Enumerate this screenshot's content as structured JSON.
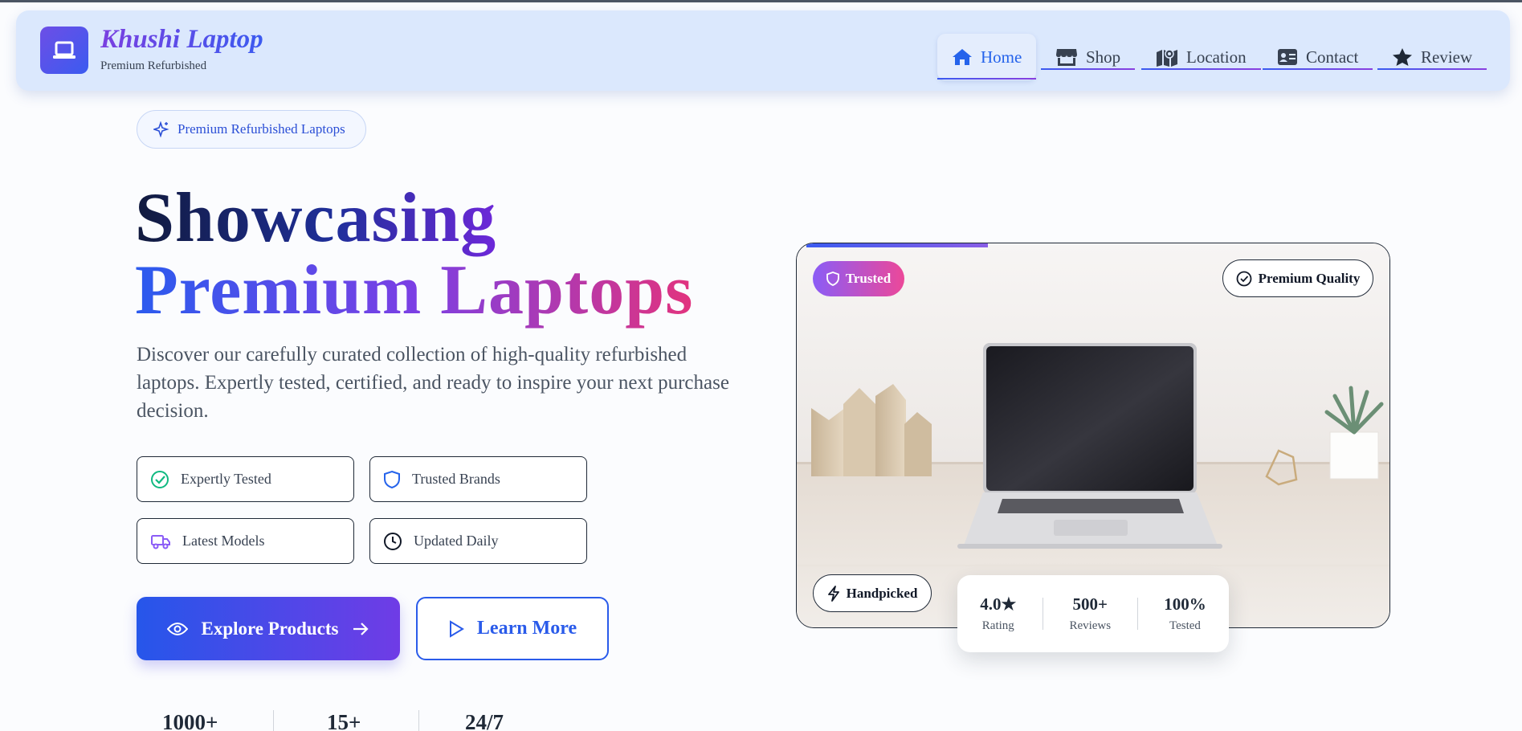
{
  "brand": {
    "name": "Khushi Laptop",
    "tagline": "Premium Refurbished"
  },
  "nav": [
    {
      "label": "Home",
      "icon": "home-icon",
      "active": true
    },
    {
      "label": "Shop",
      "icon": "store-icon",
      "active": false
    },
    {
      "label": "Location",
      "icon": "map-icon",
      "active": false
    },
    {
      "label": "Contact",
      "icon": "contact-card-icon",
      "active": false
    },
    {
      "label": "Review",
      "icon": "star-icon",
      "active": false
    }
  ],
  "hero": {
    "pill": "Premium Refurbished Laptops",
    "title_line1": "Showcasing",
    "title_line2": "Premium Laptops",
    "description": "Discover our carefully curated collection of high-quality refurbished laptops. Expertly tested, certified, and ready to inspire your next purchase decision.",
    "features": [
      {
        "label": "Expertly Tested",
        "icon": "check-circle-icon",
        "color": "#10b981"
      },
      {
        "label": "Trusted Brands",
        "icon": "shield-icon",
        "color": "#2563eb"
      },
      {
        "label": "Latest Models",
        "icon": "truck-icon",
        "color": "#8b5cf6"
      },
      {
        "label": "Updated Daily",
        "icon": "clock-icon",
        "color": "#111827"
      }
    ],
    "primary_button": "Explore Products",
    "secondary_button": "Learn More",
    "bottom_stats": [
      "1000+",
      "15+",
      "24/7"
    ]
  },
  "card": {
    "badge_trusted": "Trusted",
    "badge_quality": "Premium Quality",
    "badge_handpicked": "Handpicked",
    "stats": [
      {
        "value": "4.0★",
        "label": "Rating"
      },
      {
        "value": "500+",
        "label": "Reviews"
      },
      {
        "value": "100%",
        "label": "Tested"
      }
    ]
  },
  "colors": {
    "primary": "#2563eb",
    "accent_purple": "#7c3aed",
    "accent_pink": "#ec4899",
    "navbar_bg": "#dbe8fd"
  }
}
